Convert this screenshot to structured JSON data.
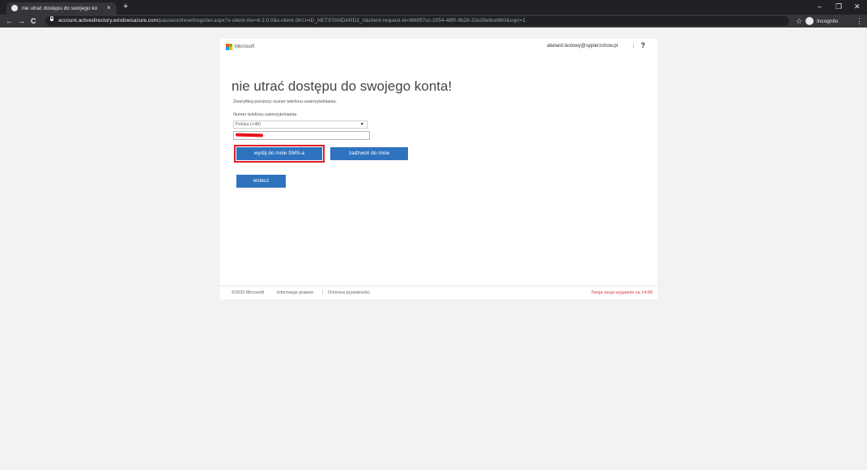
{
  "browser": {
    "tab": {
      "title": "nie utrać dostępu do swojego ko",
      "close": "×",
      "new_tab": "+"
    },
    "window_controls": {
      "minimize": "–",
      "maximize": "❐",
      "close": "✕"
    },
    "nav": {
      "back": "←",
      "forward": "→",
      "reload": "C"
    },
    "url": {
      "host": "account.activedirectory.windowsazure.com",
      "path": "/passwordreset/register.aspx?x-client-Ver=6.3.0.0&x-client-SKU=ID_NETSTANDARD2_0&client-request-id=86bf97cc-2054-48f0-9b28-32e39e9ce960&sspr=1"
    },
    "bookmark_star": "☆",
    "profile_label": "Incognito",
    "menu": "⋮"
  },
  "header": {
    "brand": "Microsoft",
    "brand_colors": [
      "#f25022",
      "#7fba00",
      "#00a4ef",
      "#ffb900"
    ],
    "user_email": "abelard.testowy@sppierzchow.pl",
    "separator": "|",
    "help": "?"
  },
  "main": {
    "title": "nie utrać dostępu do swojego konta!",
    "instruction": "Zweryfikuj poniższy numer telefonu uwierzytelniania.",
    "phone_label": "Numer telefonu uwierzytelniania",
    "country_value": "Polska (+48)",
    "select_arrow": "▼",
    "buttons": {
      "send_sms": "wyślij do mnie SMS-a",
      "call_me": "zadzwoń do mnie",
      "back": "wstecz"
    },
    "accent_color": "#2f73bf",
    "highlight_color": "#e01e26"
  },
  "footer": {
    "copyright": "©2020 Microsoft",
    "legal": "Informacje prawne",
    "separator": "|",
    "privacy": "Ochrona prywatności",
    "session": "Twoja sesja wygaśnie za 14:58"
  }
}
